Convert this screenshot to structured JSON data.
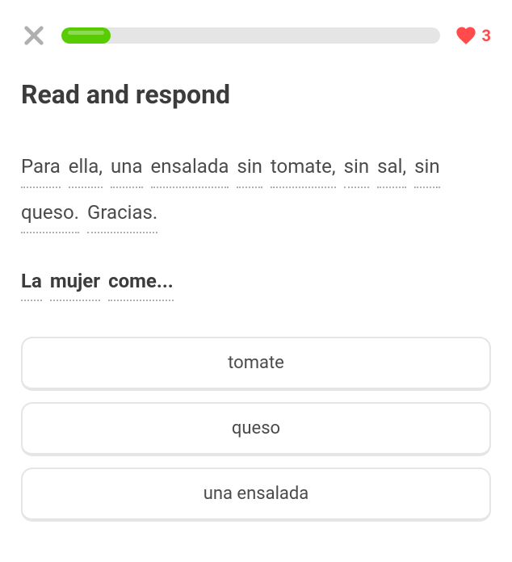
{
  "header": {
    "progress_percent": 13,
    "hearts": "3"
  },
  "instruction": "Read and respond",
  "sentence": {
    "words": [
      "Para",
      "ella,",
      "una",
      "ensalada",
      "sin",
      "tomate,",
      "sin",
      "sal,",
      "sin",
      "queso.",
      "Gracias."
    ]
  },
  "question": {
    "words": [
      "La",
      "mujer",
      "come..."
    ]
  },
  "options": [
    {
      "label": "tomate"
    },
    {
      "label": "queso"
    },
    {
      "label": "una ensalada"
    }
  ]
}
